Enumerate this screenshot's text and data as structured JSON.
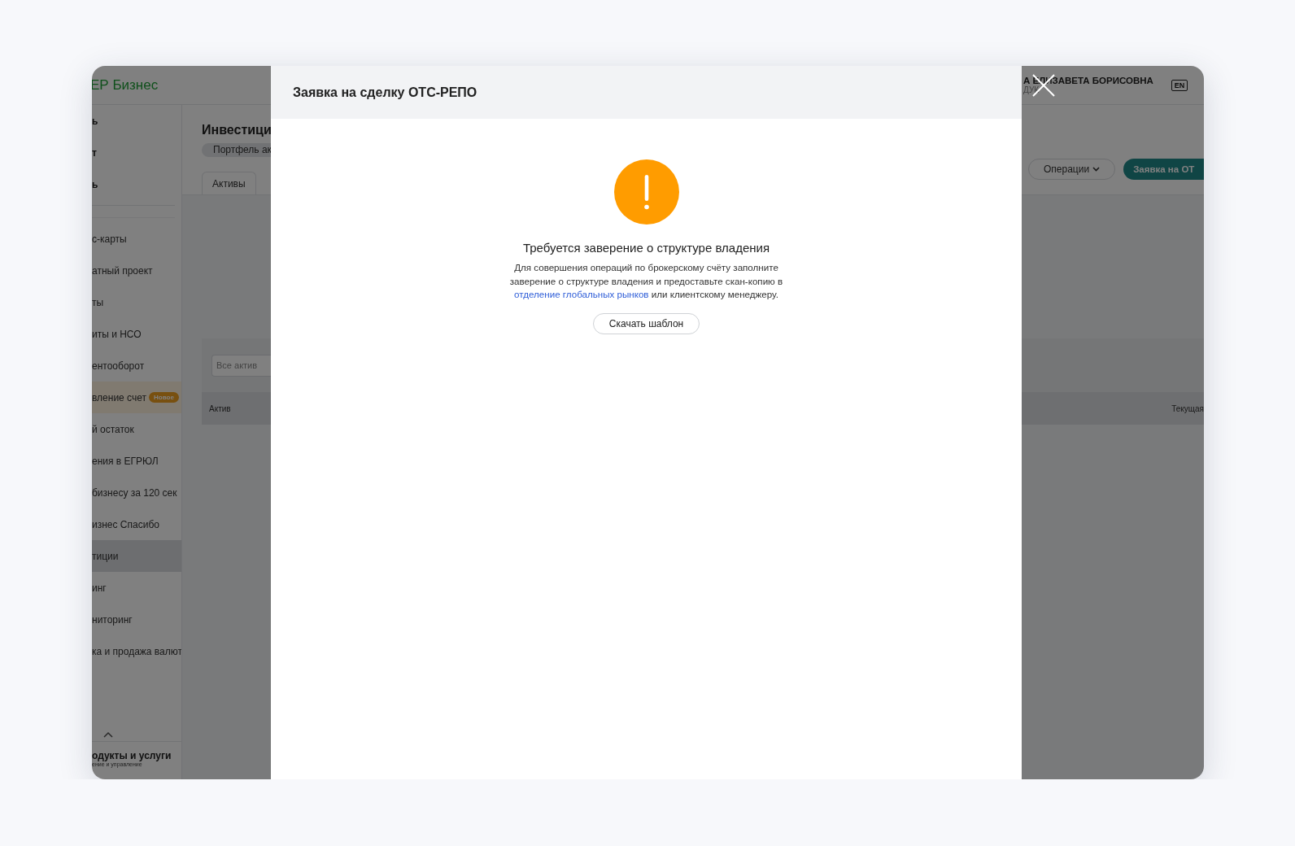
{
  "app": {
    "logo": "ЕР Бизнес",
    "user": {
      "name": "А ЕЛИЗАВЕТА БОРИСОВНА",
      "subtitle": "ДУК"
    },
    "language": "EN",
    "sidebar": {
      "top_items": [
        "ь",
        "т",
        "ь"
      ],
      "items": [
        {
          "label": "с-карты",
          "selected": false,
          "promo": false
        },
        {
          "label": "атный проект",
          "selected": false,
          "promo": false
        },
        {
          "label": "ты",
          "selected": false,
          "promo": false
        },
        {
          "label": "иты и НСО",
          "selected": false,
          "promo": false
        },
        {
          "label": "ентооборот",
          "selected": false,
          "promo": false
        },
        {
          "label": "вление счет",
          "selected": false,
          "promo": true,
          "badge": "Новое"
        },
        {
          "label": "й остаток",
          "selected": false,
          "promo": false
        },
        {
          "label": "ения в ЕГРЮЛ",
          "selected": false,
          "promo": false
        },
        {
          "label": "бизнесу за 120 сек",
          "selected": false,
          "promo": false
        },
        {
          "label": "изнес Спасибо",
          "selected": false,
          "promo": false
        },
        {
          "label": "тиции",
          "selected": true,
          "promo": false
        },
        {
          "label": "инг",
          "selected": false,
          "promo": false
        },
        {
          "label": "ниторинг",
          "selected": false,
          "promo": false
        },
        {
          "label": "ка и продажа валют",
          "selected": false,
          "promo": false
        }
      ],
      "footer": {
        "title": "одукты и услуги",
        "subtitle": "ение и управление"
      }
    },
    "page": {
      "title": "Инвестици",
      "portfolio_button": "Портфель ак",
      "tabs": [
        {
          "label": "Активы",
          "selected": true
        }
      ],
      "operations_button": "Операции",
      "request_button": "Заявка на ОТ",
      "filter": {
        "placeholder": "Все актив"
      },
      "table": {
        "columns": [
          "Актив",
          "Текущая"
        ]
      }
    }
  },
  "modal": {
    "title": "Заявка на сделку ОТС-РЕПО",
    "heading": "Требуется заверение о структуре владения",
    "message": {
      "text_before": "Для совершения операций по брокерскому счёту заполните заверение о структуре владения и предоставьте скан-копию в ",
      "link": "отделение глобальных рынков",
      "text_after": " или клиентскому менеджеру."
    },
    "download_button": "Скачать шаблон"
  }
}
